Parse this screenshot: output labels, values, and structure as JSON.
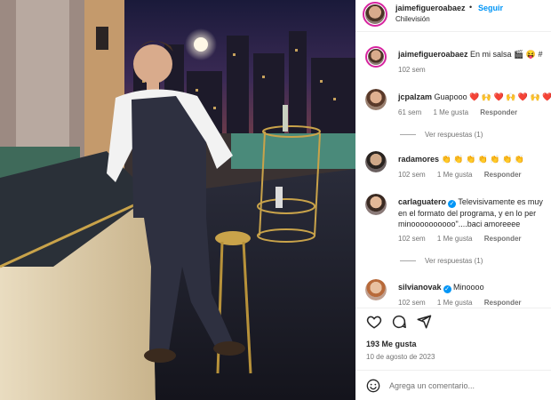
{
  "post": {
    "username": "jaimefigueroabaez",
    "separator": "•",
    "follow_label": "Seguir",
    "location": "Chilevisión",
    "caption_user": "jaimefigueroabaez",
    "caption_text": "En mi salsa",
    "caption_emojis": "🎬 😝 #",
    "caption_age": "102 sem"
  },
  "comments": [
    {
      "user": "jcpalzam",
      "text": "Guapooo",
      "emojis": "❤️ 🙌 ❤️ 🙌 ❤️ 🙌 ❤️",
      "age": "61 sem",
      "likes": "1 Me gusta",
      "reply": "Responder",
      "replies_label": "Ver respuestas (1)"
    },
    {
      "user": "radamores",
      "text": "",
      "emojis": "👏 👏 👏 👏 👏 👏 👏",
      "age": "102 sem",
      "likes": "1 Me gusta",
      "reply": "Responder"
    },
    {
      "user": "carlaguatero",
      "text": "Televisivamente es muy",
      "line2": "en el formato del programa, y en lo per",
      "line3": "minoooooooooo\"....baci amoreeee",
      "age": "102 sem",
      "likes": "1 Me gusta",
      "reply": "Responder",
      "replies_label": "Ver respuestas (1)"
    },
    {
      "user": "silvianovak",
      "text": "Minoooo",
      "age": "102 sem",
      "likes": "1 Me gusta",
      "reply": "Responder"
    }
  ],
  "actions": {
    "icons": [
      "heart-icon",
      "comment-icon",
      "share-icon"
    ],
    "likes": "193 Me gusta",
    "date": "10 de agosto de 2023"
  },
  "add_comment": {
    "placeholder": "Agrega un comentario..."
  },
  "colors": {
    "accent": "#0095f6",
    "ring": "#d6249f",
    "muted": "#737373"
  }
}
